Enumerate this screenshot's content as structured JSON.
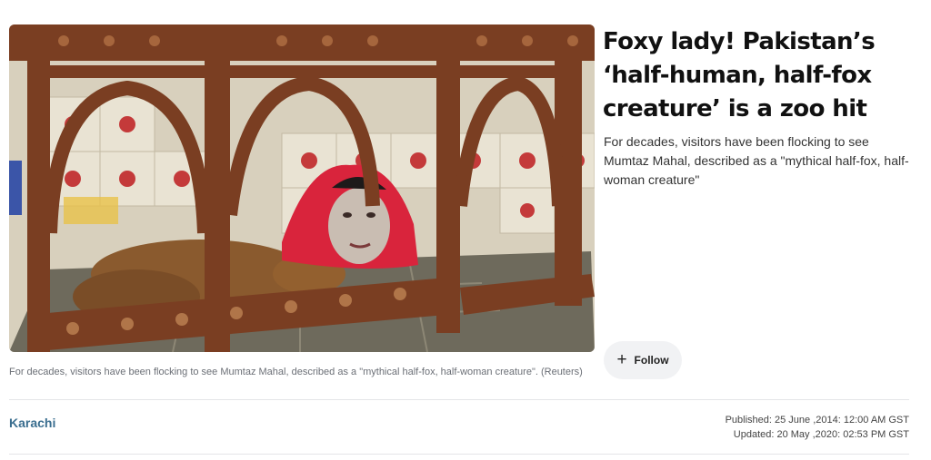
{
  "article": {
    "headline": "Foxy lady! Pakistan’s ‘half-human, half-fox creature’ is a zoo hit",
    "summary": "For decades, visitors have been flocking to see Mumtaz Mahal, described as a \"mythical half-fox, half-woman creature\"",
    "caption": "For decades, visitors have been flocking to see Mumtaz Mahal, described as a \"mythical half-fox, half-woman creature\". (Reuters)",
    "location": "Karachi",
    "published": "Published: 25 June ,2014: 12:00 AM GST",
    "updated": "Updated: 20 May ,2020: 02:53 PM GST"
  },
  "follow": {
    "label": "Follow",
    "icon": "plus-icon"
  },
  "colors": {
    "location_link": "#3a6e8f",
    "follow_bg": "#f1f2f4",
    "scarf": "#d9243c",
    "wood": "#7a3e22"
  }
}
